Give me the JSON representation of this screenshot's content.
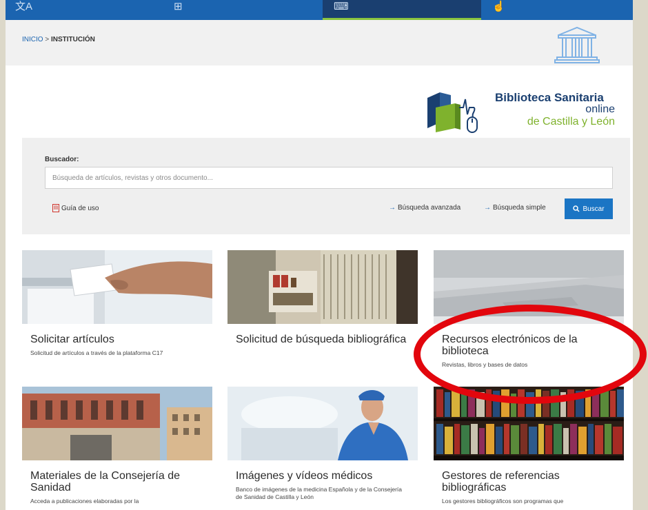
{
  "breadcrumb": {
    "home": "INICIO",
    "separator": ">",
    "current": "INSTITUCIÓN"
  },
  "nav": {
    "icons": [
      "translate-icon",
      "network-icon",
      "keyboard-icon",
      "hand-icon"
    ],
    "active_index": 2
  },
  "logo": {
    "title": "Biblioteca Sanitaria",
    "sub1": "online",
    "sub2": "de Castilla y León"
  },
  "search": {
    "label": "Buscador:",
    "placeholder": "Búsqueda de artículos, revistas y otros documento...",
    "value": "",
    "guide_link": "Guía de uso",
    "advanced_link": "Búsqueda avanzada",
    "simple_link": "Búsqueda simple",
    "button_label": "Buscar"
  },
  "cards": [
    {
      "title": "Solicitar artículos",
      "desc": "Solicitud de artículos a través de la plataforma C17"
    },
    {
      "title": "Solicitud de búsqueda bibliográfica",
      "desc": ""
    },
    {
      "title": "Recursos electrónicos de la biblioteca",
      "desc": "Revistas, libros y bases de datos"
    },
    {
      "title": "Materiales de la Consejería de Sanidad",
      "desc": "Acceda a publicaciones elaboradas por la"
    },
    {
      "title": "Imágenes y vídeos médicos",
      "desc": "Banco de imágenes de la medicina Española y de la Consejería de Sanidad de Castilla y León"
    },
    {
      "title": "Gestores de referencias bibliográficas",
      "desc": "Los gestores bibliográficos son programas que"
    }
  ],
  "colors": {
    "primary": "#1b64b0",
    "accent_green": "#8ac43f",
    "annotation_red": "#e2060d"
  }
}
